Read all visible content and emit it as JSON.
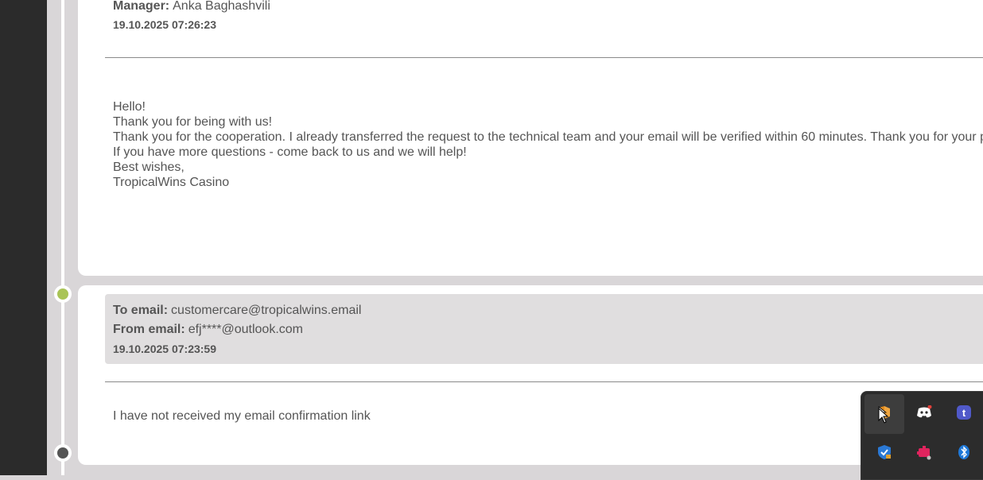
{
  "message1": {
    "manager_label": "Manager:",
    "manager_name": "Anka  Baghashvili",
    "timestamp": "19.10.2025 07:26:23",
    "body_lines": [
      "Hello!",
      "Thank you for being with us!",
      "Thank you for the cooperation. I already transferred the request to the technical team and your email will be verified within 60 minutes. Thank you for your pat",
      "If you have more questions - come back to us and we will help!",
      "Best wishes,",
      "TropicalWins Casino"
    ]
  },
  "message2": {
    "to_label": "To email:",
    "to_value": "customercare@tropicalwins.email",
    "from_label": "From email:",
    "from_value": "efj****@outlook.com",
    "timestamp": "19.10.2025 07:23:59",
    "body": "I have not received my email confirmation link"
  },
  "tray": {
    "icons": [
      "app-icon",
      "discord-icon",
      "teams-icon",
      "shield-icon",
      "puzzle-icon",
      "bluetooth-icon"
    ]
  },
  "colors": {
    "timeline_dot_green": "#a9c456",
    "timeline_dot_dark": "#555555"
  }
}
